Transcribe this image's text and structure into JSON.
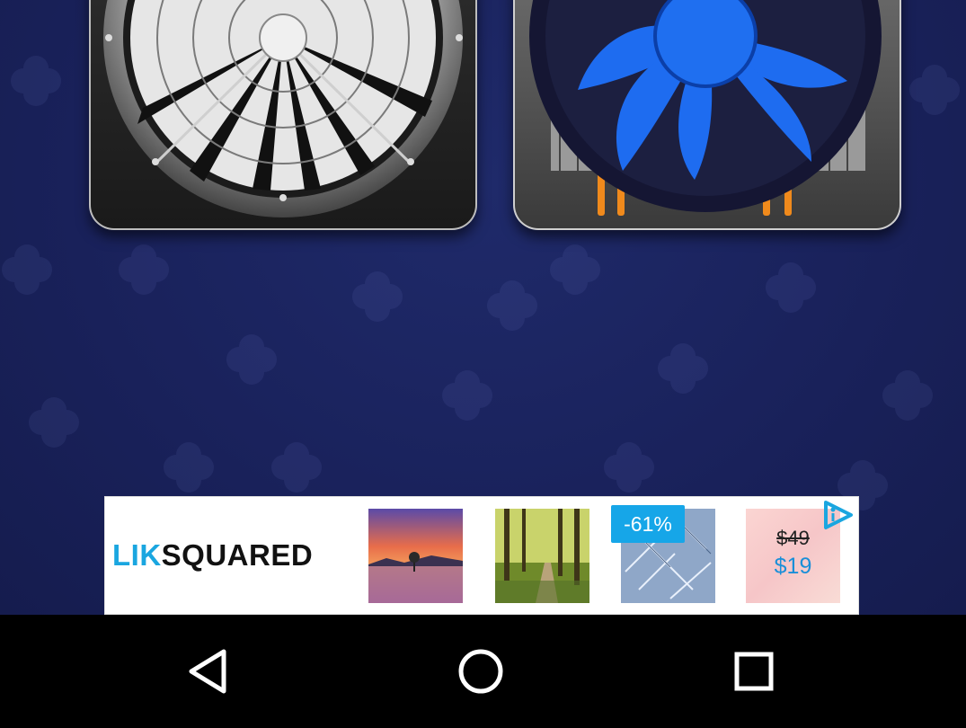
{
  "ad": {
    "brand_part1": "LIK",
    "brand_part2": "SQUARED",
    "discount_badge": "-61%",
    "old_price": "$49",
    "new_price": "$19",
    "ad_choices_icon": "ad-choices-icon",
    "images": [
      "sunset-lake-thumbnail",
      "forest-path-thumbnail",
      "frosted-pine-thumbnail"
    ]
  },
  "apps": [
    {
      "icon": "silver-fan-icon"
    },
    {
      "icon": "cpu-cooler-fan-icon"
    }
  ],
  "navigation": {
    "back_icon": "back-icon",
    "home_icon": "home-icon",
    "recents_icon": "recents-icon"
  },
  "colors": {
    "background": "#1a2259",
    "brand_blue": "#1aa6e0",
    "badge": "#16a6e8",
    "fan_blue": "#1e6cf0"
  }
}
